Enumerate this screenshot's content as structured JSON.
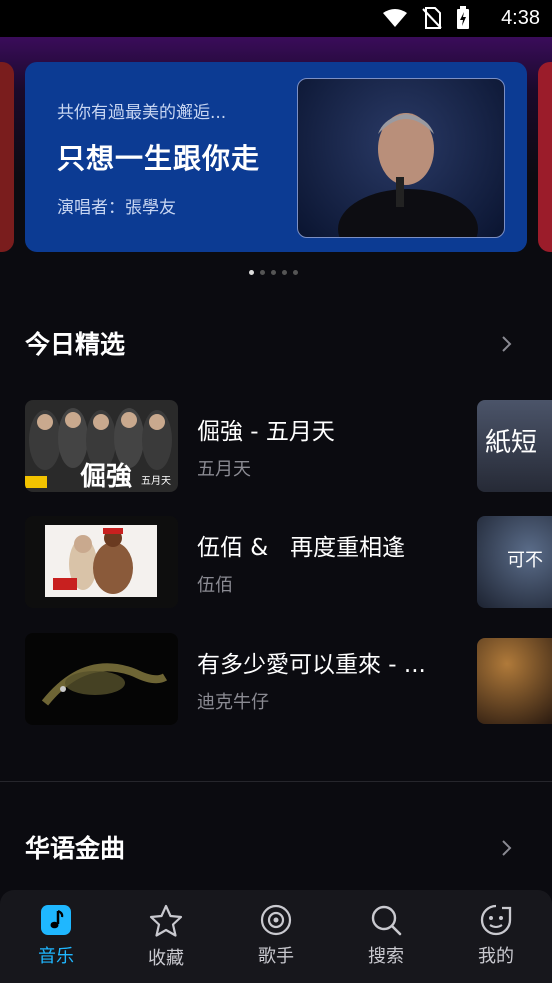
{
  "status_bar": {
    "time": "4:38"
  },
  "banner": {
    "subtitle": "共你有過最美的邂逅...",
    "title": "只想一生跟你走",
    "singer": "演唱者：張學友",
    "page_count": 5,
    "active_page": 0
  },
  "sections": {
    "daily": {
      "title": "今日精选"
    },
    "chinese_hits": {
      "title": "华语金曲"
    }
  },
  "songs": [
    {
      "title": "倔強 - 五月天",
      "artist": "五月天",
      "thumb_text": "倔強",
      "thumb_badge": "五月天"
    },
    {
      "title": "伍佰 &   再度重相逢",
      "artist": "伍佰",
      "thumb_text": "",
      "thumb_badge": ""
    },
    {
      "title": "有多少愛可以重來 - ...",
      "artist": "迪克牛仔",
      "thumb_text": "",
      "thumb_badge": ""
    }
  ],
  "side_thumbs": [
    "紙短",
    "可不",
    ""
  ],
  "tabs": [
    {
      "label": "音乐",
      "icon": "music-note-icon",
      "active": true
    },
    {
      "label": "收藏",
      "icon": "star-icon",
      "active": false
    },
    {
      "label": "歌手",
      "icon": "vinyl-record-icon",
      "active": false
    },
    {
      "label": "搜索",
      "icon": "search-icon",
      "active": false
    },
    {
      "label": "我的",
      "icon": "face-icon",
      "active": false
    }
  ],
  "colors": {
    "accent": "#1fb7ff",
    "banner_bg": "#0c3b93",
    "background": "#0b0b10"
  }
}
